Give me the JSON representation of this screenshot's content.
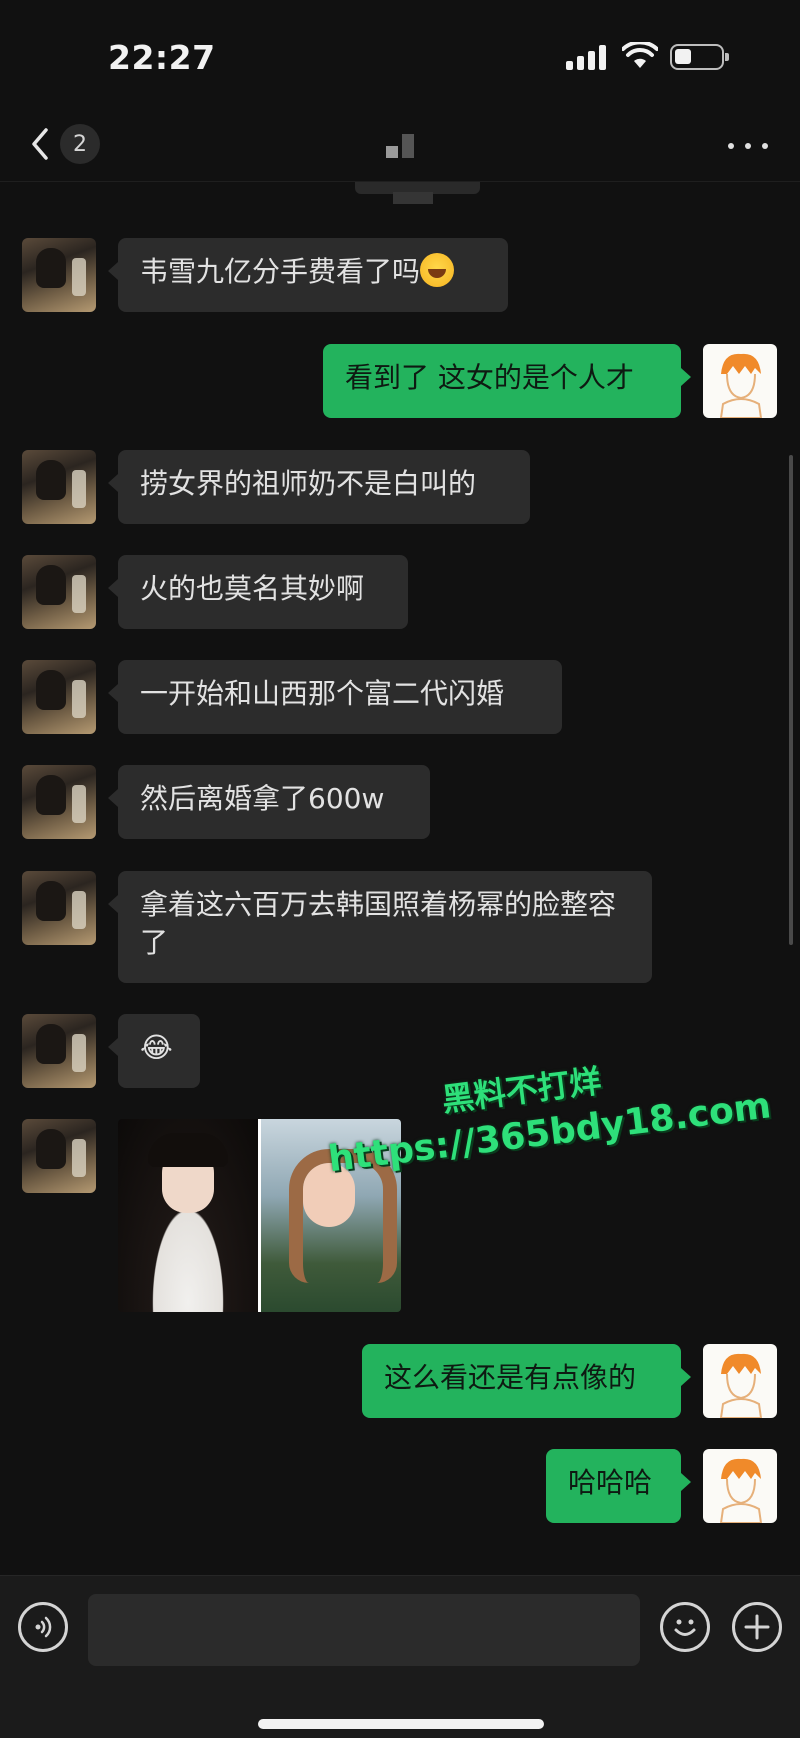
{
  "status_bar": {
    "time": "22:27"
  },
  "nav": {
    "unread_count": "2"
  },
  "messages": [
    {
      "side": "in",
      "text": "韦雪九亿分手费看了吗",
      "emoji": "laughing-crying"
    },
    {
      "side": "out",
      "text": "看到了 这女的是个人才"
    },
    {
      "side": "in",
      "text": "捞女界的祖师奶不是白叫的"
    },
    {
      "side": "in",
      "text": "火的也莫名其妙啊"
    },
    {
      "side": "in",
      "text": "一开始和山西那个富二代闪婚"
    },
    {
      "side": "in",
      "text": "然后离婚拿了600w"
    },
    {
      "side": "in",
      "text": "拿着这六百万去韩国照着杨幂的脸整容了"
    },
    {
      "side": "in",
      "text": "😂"
    },
    {
      "side": "in",
      "type": "image",
      "text": ""
    },
    {
      "side": "out",
      "text": "这么看还是有点像的"
    },
    {
      "side": "out",
      "text": "哈哈哈"
    }
  ],
  "watermark": {
    "line1": "黑料不打烊",
    "line2": "https://365bdy18.com"
  },
  "input_bar": {
    "value": ""
  },
  "colors": {
    "outgoing_bubble": "#23b35d",
    "incoming_bubble": "#2c2c2c",
    "background": "#111111"
  },
  "icons": [
    "back-icon",
    "more-icon",
    "voice-icon",
    "emoji-icon",
    "add-icon"
  ]
}
